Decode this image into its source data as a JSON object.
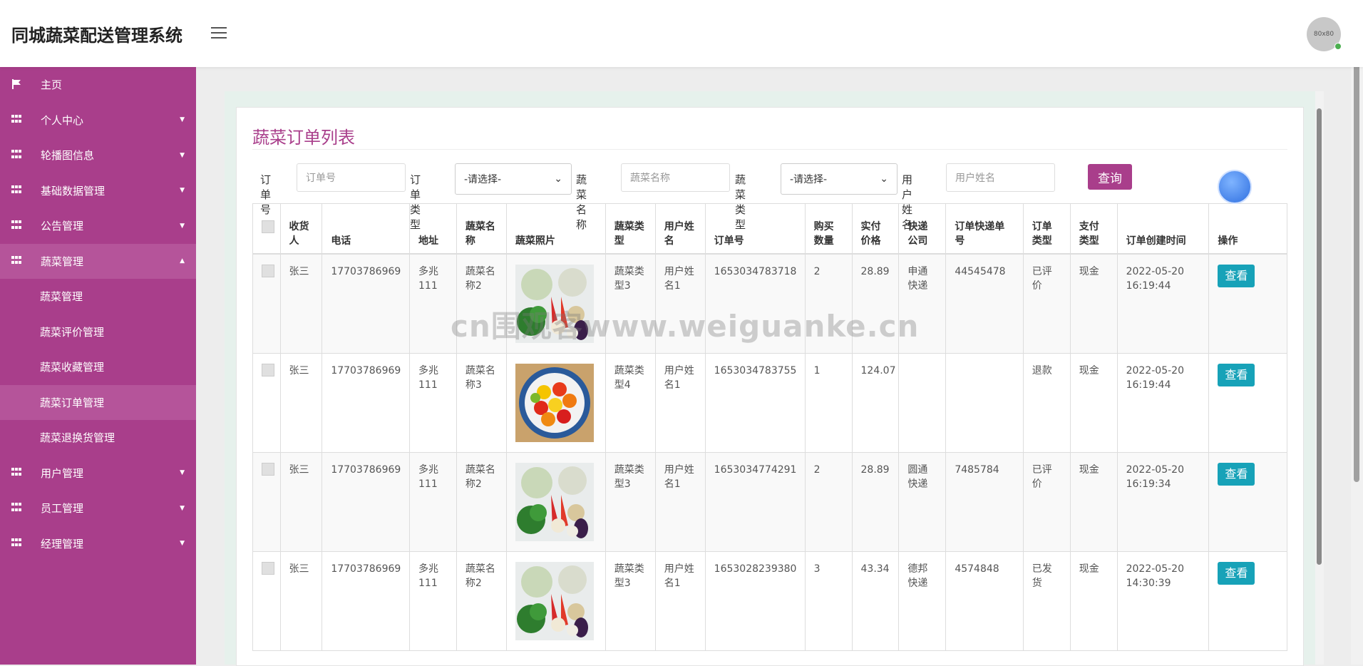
{
  "app": {
    "title": "同城蔬菜配送管理系统",
    "avatar_text": "80x80"
  },
  "sidebar": {
    "items": [
      {
        "label": "主页",
        "icon": "flag-icon",
        "caret": ""
      },
      {
        "label": "个人中心",
        "icon": "grid-icon",
        "caret": "▼"
      },
      {
        "label": "轮播图信息",
        "icon": "grid-icon",
        "caret": "▼"
      },
      {
        "label": "基础数据管理",
        "icon": "grid-icon",
        "caret": "▼"
      },
      {
        "label": "公告管理",
        "icon": "grid-icon",
        "caret": "▼"
      },
      {
        "label": "蔬菜管理",
        "icon": "grid-icon",
        "caret": "▲"
      },
      {
        "label": "用户管理",
        "icon": "grid-icon",
        "caret": "▼"
      },
      {
        "label": "员工管理",
        "icon": "grid-icon",
        "caret": "▼"
      },
      {
        "label": "经理管理",
        "icon": "grid-icon",
        "caret": "▼"
      }
    ],
    "subitems": [
      "蔬菜管理",
      "蔬菜评价管理",
      "蔬菜收藏管理",
      "蔬菜订单管理",
      "蔬菜退换货管理"
    ],
    "colors": {
      "bg": "#a93e8b",
      "active": "#b5549a"
    }
  },
  "page": {
    "title": "蔬菜订单列表"
  },
  "filters": {
    "order_no_label": "订单号",
    "order_no_placeholder": "订单号",
    "order_type_label": "订单类型",
    "order_type_value": "-请选择-",
    "veg_name_label": "蔬菜名称",
    "veg_name_placeholder": "蔬菜名称",
    "veg_type_label": "蔬菜类型",
    "veg_type_value": "-请选择-",
    "user_name_label": "用户姓名",
    "user_name_placeholder": "用户姓名",
    "query_label": "查询"
  },
  "table": {
    "headers": [
      "收货人",
      "电话",
      "地址",
      "蔬菜名称",
      "蔬菜照片",
      "蔬菜类型",
      "用户姓名",
      "订单号",
      "购买数量",
      "实付价格",
      "快递公司",
      "订单快递单号",
      "订单类型",
      "支付类型",
      "订单创建时间",
      "操作"
    ],
    "rows": [
      {
        "receiver": "张三",
        "phone": "17703786969",
        "address": "多兆111",
        "veg_name": "蔬菜名称2",
        "photo": "mixed-vegetables",
        "veg_type": "蔬菜类型3",
        "user": "用户姓名1",
        "order_no": "1653034783718",
        "qty": "2",
        "price": "28.89",
        "courier": "申通快递",
        "tracking": "44545478",
        "order_type": "已评价",
        "pay_type": "现金",
        "created": "2022-05-20 16:19:44",
        "action": "查看"
      },
      {
        "receiver": "张三",
        "phone": "17703786969",
        "address": "多兆111",
        "veg_name": "蔬菜名称3",
        "photo": "peppers",
        "veg_type": "蔬菜类型4",
        "user": "用户姓名1",
        "order_no": "1653034783755",
        "qty": "1",
        "price": "124.07",
        "courier": "",
        "tracking": "",
        "order_type": "退款",
        "pay_type": "现金",
        "created": "2022-05-20 16:19:44",
        "action": "查看"
      },
      {
        "receiver": "张三",
        "phone": "17703786969",
        "address": "多兆111",
        "veg_name": "蔬菜名称2",
        "photo": "mixed-vegetables",
        "veg_type": "蔬菜类型3",
        "user": "用户姓名1",
        "order_no": "1653034774291",
        "qty": "2",
        "price": "28.89",
        "courier": "圆通快递",
        "tracking": "7485784",
        "order_type": "已评价",
        "pay_type": "现金",
        "created": "2022-05-20 16:19:34",
        "action": "查看"
      },
      {
        "receiver": "张三",
        "phone": "17703786969",
        "address": "多兆111",
        "veg_name": "蔬菜名称2",
        "photo": "mixed-vegetables",
        "veg_type": "蔬菜类型3",
        "user": "用户姓名1",
        "order_no": "1653028239380",
        "qty": "3",
        "price": "43.34",
        "courier": "德邦快递",
        "tracking": "4574848",
        "order_type": "已发货",
        "pay_type": "现金",
        "created": "2022-05-20 14:30:39",
        "action": "查看"
      }
    ]
  },
  "watermark": "cn围观客www.weiguanke.cn"
}
